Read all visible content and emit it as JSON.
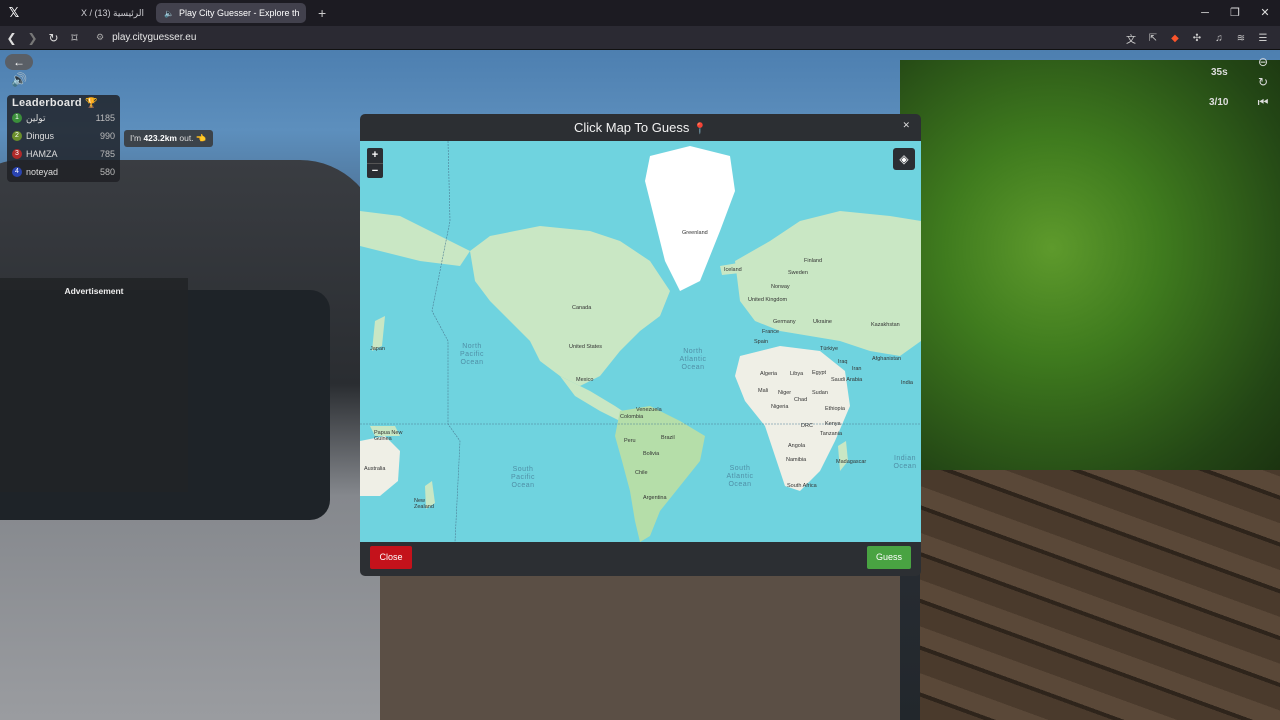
{
  "browser": {
    "tabs": [
      {
        "label": "X / الرئيسية (13)"
      },
      {
        "label": "Play City Guesser - Explore th"
      }
    ],
    "url": "play.cityguesser.eu"
  },
  "game": {
    "leaderboard": {
      "title": "Leaderboard",
      "rows": [
        {
          "rank": "1",
          "name": "تولين",
          "score": "1185",
          "color": "#3b8f3b"
        },
        {
          "rank": "2",
          "name": "Dingus",
          "score": "990",
          "color": "#6b8f2b"
        },
        {
          "rank": "3",
          "name": "HAMZA",
          "score": "785",
          "color": "#b02a2a"
        },
        {
          "rank": "4",
          "name": "noteyad",
          "score": "580",
          "color": "#2a44b0"
        }
      ]
    },
    "tooltip": {
      "prefix": "I'm ",
      "distance": "423.2km",
      "suffix": " out."
    },
    "ad_label": "Advertisement",
    "timer": "35s",
    "round": "3/10"
  },
  "modal": {
    "title": "Click Map To Guess",
    "close_label": "Close",
    "guess_label": "Guess",
    "zoom_in": "+",
    "zoom_out": "−",
    "map_labels": {
      "greenland": "Greenland",
      "iceland": "Iceland",
      "canada": "Canada",
      "united_states": "United States",
      "mexico": "Mexico",
      "japan": "Japan",
      "sweden": "Sweden",
      "finland": "Finland",
      "norway": "Norway",
      "united_kingdom": "United Kingdom",
      "germany": "Germany",
      "ukraine": "Ukraine",
      "kazakhstan": "Kazakhstan",
      "france": "France",
      "spain": "Spain",
      "turkiye": "Türkiye",
      "iraq": "Iraq",
      "iran": "Iran",
      "afghanistan": "Afghanistan",
      "algeria": "Algeria",
      "libya": "Libya",
      "egypt": "Egypt",
      "saudi_arabia": "Saudi Arabia",
      "india": "India",
      "mali": "Mali",
      "niger": "Niger",
      "chad": "Chad",
      "sudan": "Sudan",
      "nigeria": "Nigeria",
      "ethiopia": "Ethiopia",
      "venezuela": "Venezuela",
      "colombia": "Colombia",
      "drc": "DRC",
      "kenya": "Kenya",
      "tanzania": "Tanzania",
      "brazil": "Brazil",
      "peru": "Peru",
      "bolivia": "Bolivia",
      "angola": "Angola",
      "namibia": "Namibia",
      "madagascar": "Madagascar",
      "south_africa": "South Africa",
      "chile": "Chile",
      "argentina": "Argentina",
      "papua": "Papua New Guinea",
      "australia": "Australia",
      "new_zealand": "New Zealand",
      "north_pacific": "North Pacific Ocean",
      "north_atlantic": "North Atlantic Ocean",
      "south_pacific": "South Pacific Ocean",
      "south_atlantic": "South Atlantic Ocean",
      "indian": "Indian Ocean"
    }
  }
}
